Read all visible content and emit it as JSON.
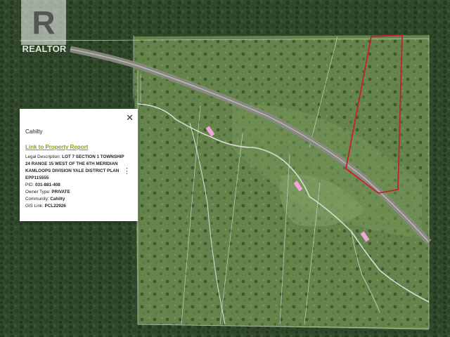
{
  "map": {
    "type": "satellite",
    "colors": {
      "forest": "#2f4527",
      "meadow": "#64814a",
      "road": "#9a9a90",
      "parcel": "#c0242a",
      "stream": "#e8e8e8",
      "marker": "#f0a6dc"
    }
  },
  "logo": {
    "icon": "realtor-r-logo",
    "text": "REALTOR"
  },
  "popup": {
    "title": "Cahilty",
    "link": "Link to Property Report",
    "legal_label": "Legal Description: ",
    "legal_value": "LOT 7 SECTION 1 TOWNSHIP 24 RANGE 15 WEST OF THE 6TH MERIDIAN KAMLOOPS DIVISION YALE DISTRICT PLAN EPP115555",
    "pid_label": "PID: ",
    "pid_value": "031-881-408",
    "owner_label": "Owner Type: ",
    "owner_value": "PRIVATE",
    "community_label": "Community: ",
    "community_value": "Cahilty",
    "gis_label": "GIS Link: ",
    "gis_value": "PCL22926",
    "close_icon": "close-icon",
    "menu_icon": "kebab-menu-icon"
  }
}
